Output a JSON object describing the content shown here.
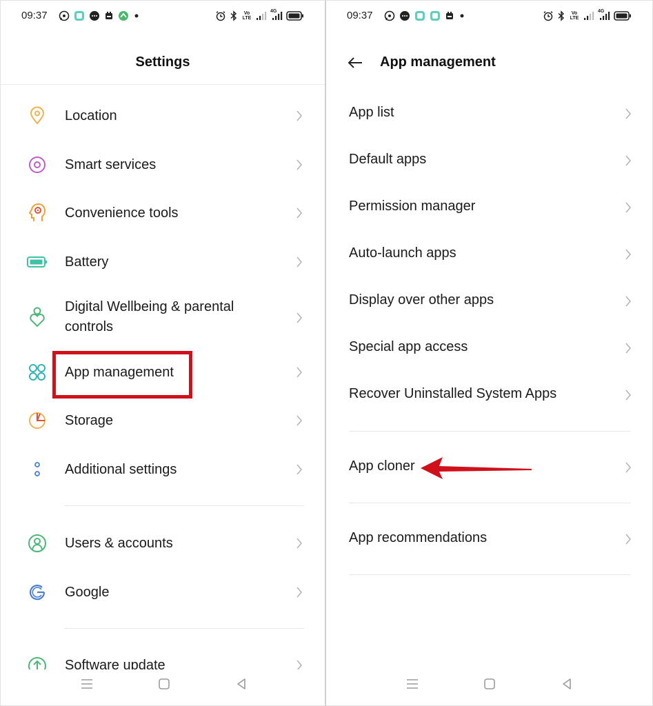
{
  "left": {
    "status": {
      "time": "09:37",
      "volte": "Vo\nLTE",
      "net": "4G"
    },
    "title": "Settings",
    "items": [
      {
        "label": "Location",
        "icon": "location-icon"
      },
      {
        "label": "Smart services",
        "icon": "smart-services-icon"
      },
      {
        "label": "Convenience tools",
        "icon": "convenience-tools-icon"
      },
      {
        "label": "Battery",
        "icon": "battery-icon"
      },
      {
        "label": "Digital Wellbeing & parental controls",
        "icon": "wellbeing-icon"
      },
      {
        "label": "App management",
        "icon": "app-management-icon"
      },
      {
        "label": "Storage",
        "icon": "storage-icon"
      },
      {
        "label": "Additional settings",
        "icon": "additional-settings-icon"
      },
      {
        "label": "Users & accounts",
        "icon": "users-accounts-icon"
      },
      {
        "label": "Google",
        "icon": "google-icon"
      },
      {
        "label": "Software update",
        "icon": "software-update-icon"
      }
    ]
  },
  "right": {
    "status": {
      "time": "09:37",
      "volte": "Vo\nLTE",
      "net": "4G"
    },
    "title": "App management",
    "items": [
      {
        "label": "App list"
      },
      {
        "label": "Default apps"
      },
      {
        "label": "Permission manager"
      },
      {
        "label": "Auto-launch apps"
      },
      {
        "label": "Display over other apps"
      },
      {
        "label": "Special app access"
      },
      {
        "label": "Recover Uninstalled System Apps"
      },
      {
        "label": "App cloner"
      },
      {
        "label": "App recommendations"
      }
    ]
  },
  "colors": {
    "highlight": "#d0101b",
    "arrow": "#d0101b",
    "chevron": "#b5b5b5"
  }
}
